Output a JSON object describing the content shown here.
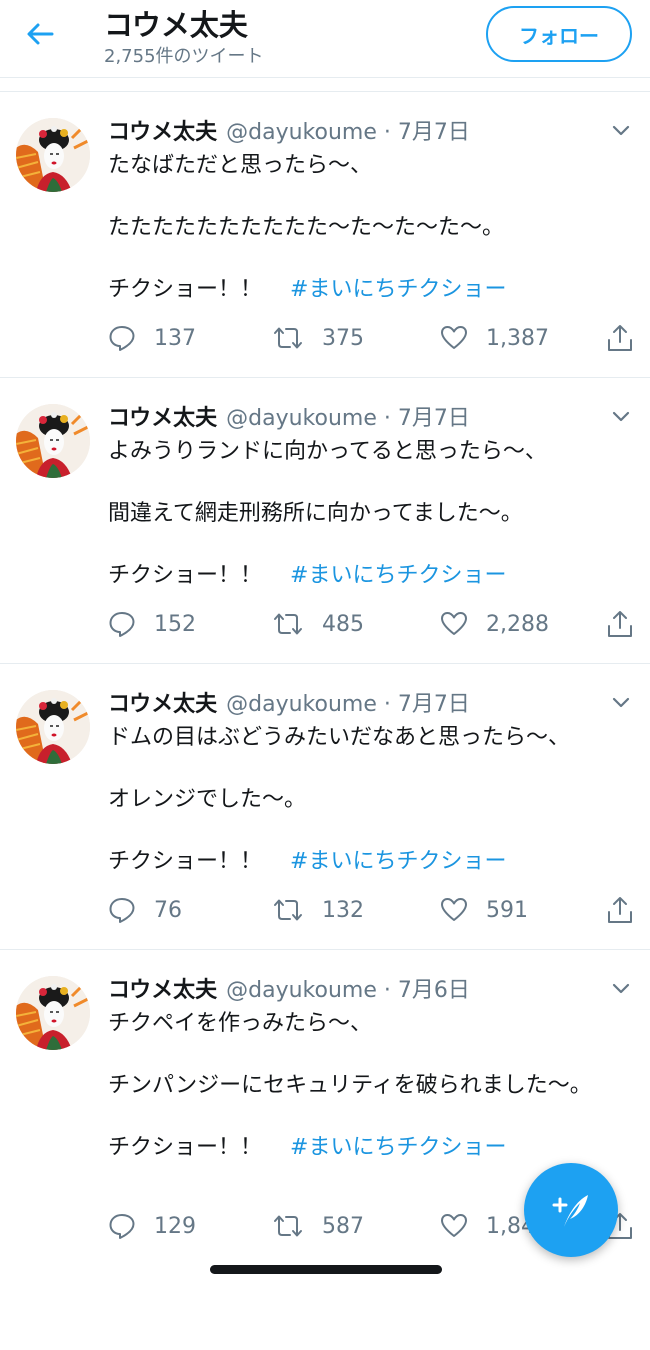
{
  "header": {
    "title": "コウメ太夫",
    "tweet_count": "2,755件のツイート",
    "follow_label": "フォロー"
  },
  "colors": {
    "accent": "#1da1f2",
    "hashtag": "#1b95e0",
    "secondary_text": "#657786",
    "text": "#14171a",
    "divider": "#e6ecf0"
  },
  "icons": [
    "back-arrow-icon",
    "chevron-down-icon",
    "reply-icon",
    "retweet-icon",
    "like-icon",
    "share-icon",
    "compose-tweet-icon"
  ],
  "tweets": [
    {
      "name": "コウメ太夫",
      "handle": "@dayukoume",
      "dot": "·",
      "date": "7月7日",
      "line1": "たなばただと思ったら〜、",
      "line2": "たたたたたたたたたた〜た〜た〜た〜。",
      "line3": "チクショー！！",
      "hashtag": "#まいにちチクショー",
      "replies": "137",
      "retweets": "375",
      "likes": "1,387"
    },
    {
      "name": "コウメ太夫",
      "handle": "@dayukoume",
      "dot": "·",
      "date": "7月7日",
      "line1": "よみうりランドに向かってると思ったら〜、",
      "line2": "間違えて網走刑務所に向かってました〜。",
      "line3": "チクショー！！",
      "hashtag": "#まいにちチクショー",
      "replies": "152",
      "retweets": "485",
      "likes": "2,288"
    },
    {
      "name": "コウメ太夫",
      "handle": "@dayukoume",
      "dot": "·",
      "date": "7月7日",
      "line1": "ドムの目はぶどうみたいだなあと思ったら〜、",
      "line2": "オレンジでした〜。",
      "line3": "チクショー！！",
      "hashtag": "#まいにちチクショー",
      "replies": "76",
      "retweets": "132",
      "likes": "591"
    },
    {
      "name": "コウメ太夫",
      "handle": "@dayukoume",
      "dot": "·",
      "date": "7月6日",
      "line1": "チクペイを作っみたら〜、",
      "line2": "チンパンジーにセキュリティを破られました〜。",
      "line3": "チクショー！！",
      "hashtag": "#まいにちチクショー",
      "replies": "129",
      "retweets": "587",
      "likes": "1,84"
    }
  ]
}
